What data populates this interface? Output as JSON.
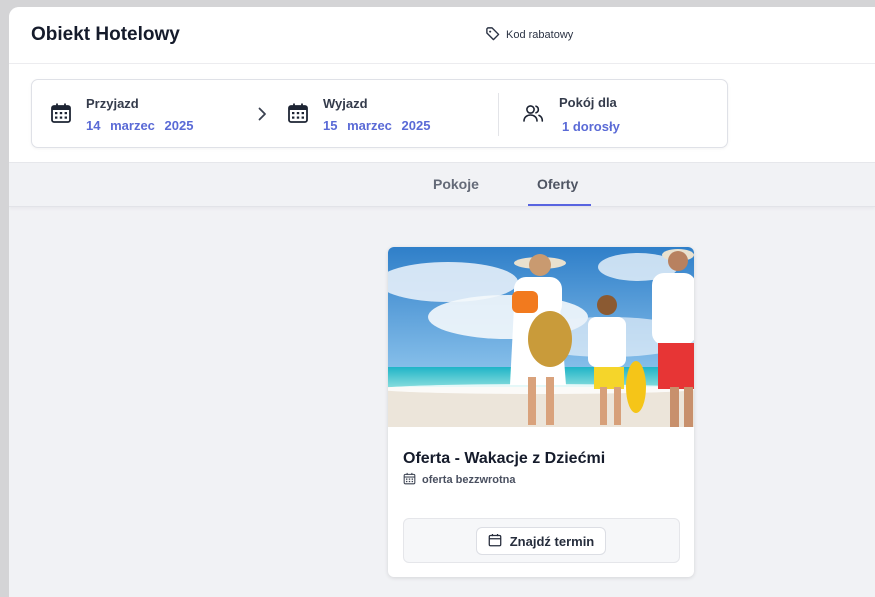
{
  "header": {
    "brand": "Obiekt Hotelowy",
    "promo_label": "Kod rabatowy"
  },
  "search": {
    "arrival": {
      "label": "Przyjazd",
      "day": "14",
      "month": "marzec",
      "year": "2025"
    },
    "departure": {
      "label": "Wyjazd",
      "day": "15",
      "month": "marzec",
      "year": "2025"
    },
    "guests": {
      "label": "Pokój dla",
      "value": "1 dorosły"
    }
  },
  "tabs": [
    {
      "label": "Pokoje",
      "active": false
    },
    {
      "label": "Oferty",
      "active": true
    }
  ],
  "offer": {
    "title": "Oferta - Wakacje z Dziećmi",
    "tag": "oferta bezzwrotna",
    "button_label": "Znajdź termin"
  },
  "colors": {
    "accent": "#5864e0",
    "date_text": "#5a6ad6"
  }
}
